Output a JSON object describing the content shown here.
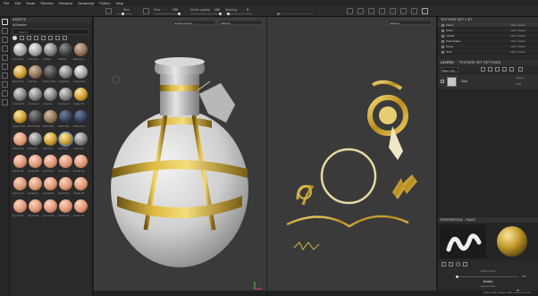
{
  "menu": [
    "File",
    "Edit",
    "Mode",
    "Window",
    "Viewport",
    "Javascript",
    "Python",
    "Help"
  ],
  "toolbar": {
    "size_label": "Size",
    "flow_label": "Flow",
    "flow_value": "100",
    "stroke_opacity_label": "Stroke opacity",
    "stroke_opacity_value": "100",
    "spacing_label": "Spacing",
    "spacing_value": "5"
  },
  "assets": {
    "title": "ASSETS",
    "library": "All libraries",
    "search_placeholder": "Search",
    "labels": [
      "Aluminium",
      "Aluminium",
      "Artificial",
      "Artificial",
      "Baked Lig",
      "Brass Pure",
      "Calf Skin",
      "Carbon Fibe",
      "Coated Me",
      "Cobalt Pure",
      "Concrete B",
      "Concrete C",
      "Concrete",
      "Concrete S",
      "Copper Pu",
      "Copper Pure",
      "Denim Rivet",
      "Fabric Bas",
      "Fabric Bas",
      "Fabric Soft",
      "Fabric Suit",
      "Footprints",
      "Gold Pure",
      "Gold Pure",
      "Ground Gr",
      "Human Ba",
      "Human Bo",
      "Human Ey",
      "Human Fe",
      "Human He",
      "Human Ch",
      "Human Le",
      "Human Ne",
      "Human No",
      "Human Sh",
      "Human Wr",
      "Human Wr",
      "Human Wr",
      "Human Wr",
      "Human Wr"
    ]
  },
  "viewport": {
    "camera": "Default camera",
    "channel_left": "Material",
    "channel_right": "Material"
  },
  "texture_set_list": {
    "title": "TEXTURE SET LIST",
    "items": [
      {
        "name": "Frame",
        "shader": "Main shader"
      },
      {
        "name": "Glass",
        "shader": "Main shader"
      },
      {
        "name": "Liquid1",
        "shader": "Main shader"
      },
      {
        "name": "PotionGlass",
        "shader": "Main shader"
      },
      {
        "name": "String",
        "shader": "Main shader"
      },
      {
        "name": "Top1",
        "shader": "Main shader"
      }
    ]
  },
  "layers": {
    "tab_layers": "LAYERS",
    "tab_settings": "TEXTURE SET SETTINGS",
    "channel": "Base color",
    "layer_name": "Gold",
    "blend": "Norm",
    "opacity": "100"
  },
  "properties": {
    "title": "PROPERTIES - PAINT",
    "color_label": "uniform color",
    "value1": "0.2",
    "metallic_label": "Metallic",
    "metallic_sub": "uniform color",
    "value2": "1"
  },
  "status": "Cache Disk Usage: 82% | Version: 8.3.0",
  "colors": {
    "gold": "#c9a227",
    "bg": "#3a3a3a",
    "accent": "#4a90d9"
  }
}
